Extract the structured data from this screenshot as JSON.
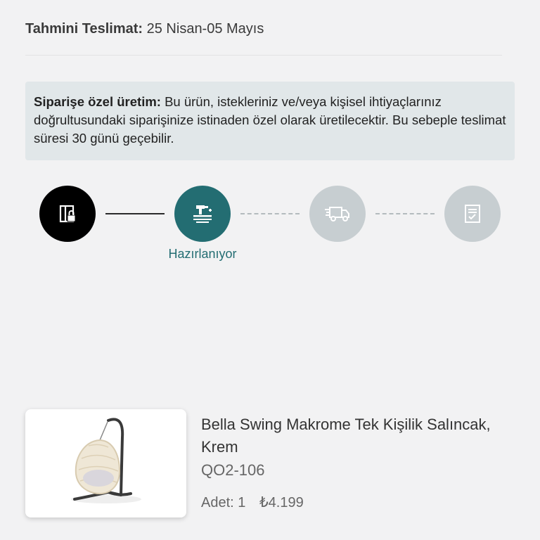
{
  "delivery": {
    "label": "Tahmini Teslimat:",
    "value": "25 Nisan-05 Mayıs"
  },
  "notice": {
    "label": "Siparişe özel üretim:",
    "text": "Bu ürün, istekleriniz ve/veya kişisel ihtiyaçlarınız doğrultusundaki siparişinize istinaden özel olarak üretilecektir. Bu sebeple teslimat süresi 30 günü geçebilir."
  },
  "tracker": {
    "steps": [
      {
        "icon": "order-lock-icon",
        "state": "done"
      },
      {
        "icon": "production-icon",
        "state": "active",
        "label": "Hazırlanıyor"
      },
      {
        "icon": "delivery-truck-icon",
        "state": "pending"
      },
      {
        "icon": "checklist-icon",
        "state": "pending"
      }
    ],
    "colors": {
      "active": "#236d72",
      "done": "#000000",
      "pending": "#c7ced1"
    }
  },
  "product": {
    "title": "Bella Swing Makrome Tek Kişilik Salıncak, Krem",
    "sku": "QO2-106",
    "quantity_label": "Adet: 1",
    "price": "₺4.199"
  }
}
